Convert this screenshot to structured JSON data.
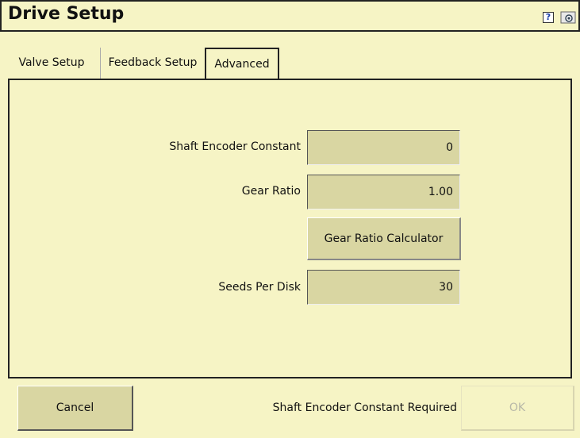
{
  "window": {
    "title": "Drive Setup"
  },
  "header": {
    "help_icon": "help-icon",
    "camera_icon": "camera-icon",
    "help_glyph": "?"
  },
  "tabs": [
    {
      "label": "Valve Setup",
      "active": false
    },
    {
      "label": "Feedback Setup",
      "active": true
    },
    {
      "label": "Advanced",
      "active": false
    }
  ],
  "fields": {
    "shaft_encoder": {
      "label": "Shaft Encoder Constant",
      "value": "0"
    },
    "gear_ratio": {
      "label": "Gear Ratio",
      "value": "1.00"
    },
    "calculator_button": "Gear Ratio Calculator",
    "seeds_per_disk": {
      "label": "Seeds Per Disk",
      "value": "30"
    }
  },
  "footer": {
    "cancel_label": "Cancel",
    "status": "Shaft Encoder Constant Required",
    "ok_label": "OK",
    "ok_enabled": false
  },
  "colors": {
    "background": "#f6f4c5",
    "field": "#d9d6a2",
    "border": "#222222"
  }
}
